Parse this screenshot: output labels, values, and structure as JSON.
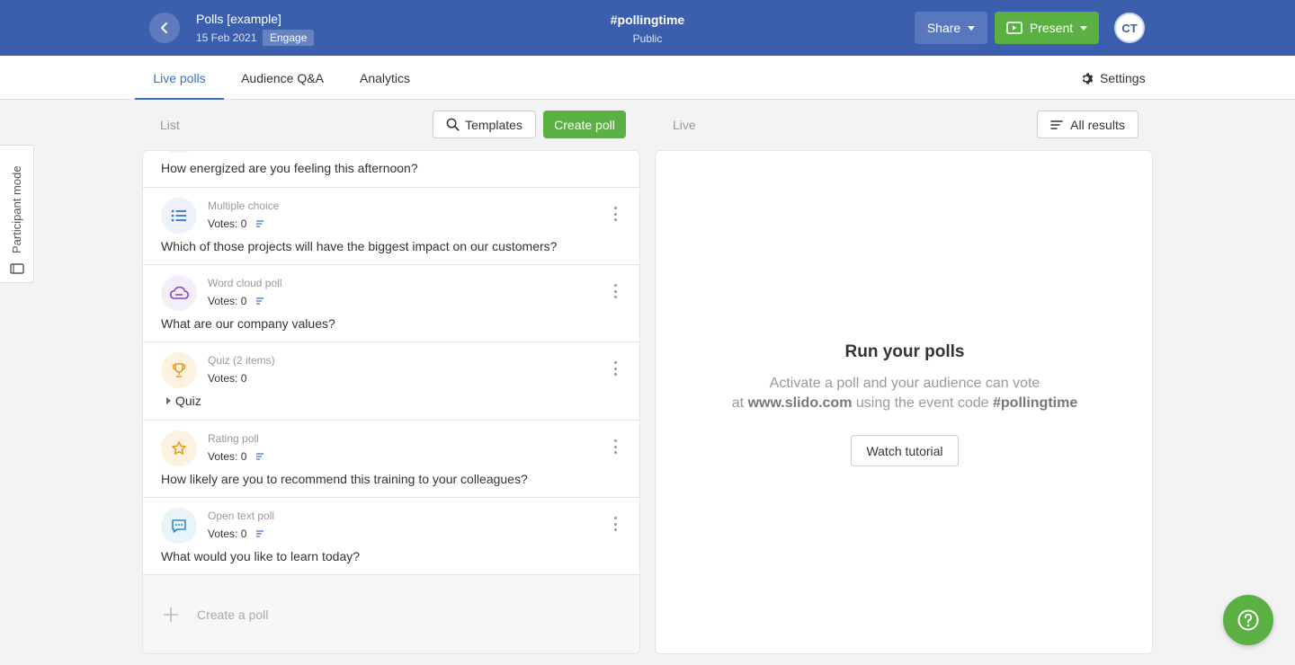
{
  "header": {
    "event_title": "Polls [example]",
    "event_date": "15 Feb 2021",
    "event_badge": "Engage",
    "event_code": "#pollingtime",
    "event_privacy": "Public",
    "share_label": "Share",
    "present_label": "Present",
    "avatar_initials": "CT",
    "bg_color": "#3c5fad"
  },
  "tabs": [
    {
      "label": "Live polls",
      "active": true
    },
    {
      "label": "Audience Q&A",
      "active": false
    },
    {
      "label": "Analytics",
      "active": false
    }
  ],
  "settings_label": "Settings",
  "toolbar": {
    "list_label": "List",
    "templates_label": "Templates",
    "create_poll_label": "Create poll",
    "live_label": "Live",
    "all_results_label": "All results"
  },
  "participant_mode_label": "Participant mode",
  "polls": {
    "first_question": "How energized are you feeling this afternoon?",
    "items": [
      {
        "type": "Multiple choice",
        "votes": "Votes: 0",
        "question": "Which of those projects will have the biggest impact on our customers?",
        "icon": "list-icon"
      },
      {
        "type": "Word cloud poll",
        "votes": "Votes: 0",
        "question": "What are our company values?",
        "icon": "cloud-icon"
      },
      {
        "type": "Quiz (2 items)",
        "votes": "Votes: 0",
        "question": "Quiz",
        "icon": "trophy-icon"
      },
      {
        "type": "Rating poll",
        "votes": "Votes: 0",
        "question": "How likely are you to recommend this training to your colleagues?",
        "icon": "star-icon"
      },
      {
        "type": "Open text poll",
        "votes": "Votes: 0",
        "question": "What would you like to learn today?",
        "icon": "chat-icon"
      }
    ],
    "create_label": "Create a poll"
  },
  "live": {
    "title": "Run your polls",
    "line1": "Activate a poll and your audience can vote",
    "line2_prefix": "at ",
    "line2_site": "www.slido.com",
    "line2_mid": " using the event code ",
    "line2_code": "#pollingtime",
    "tutorial_label": "Watch tutorial"
  },
  "colors": {
    "accent": "#3a70c6",
    "green": "#5bb043"
  }
}
